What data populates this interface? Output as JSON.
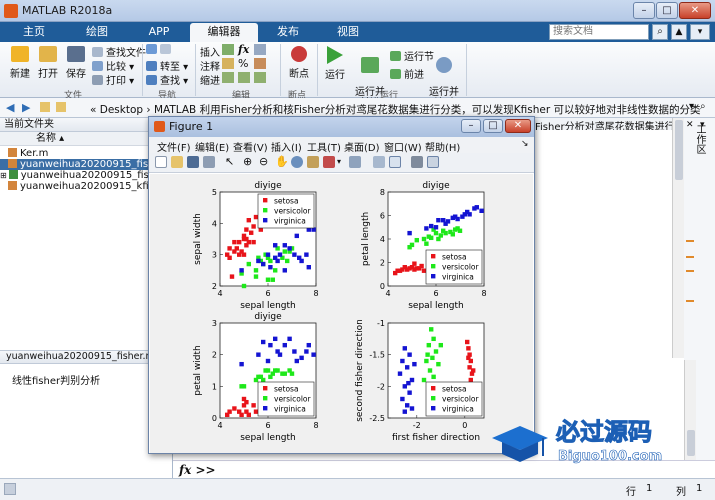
{
  "app": {
    "title": "MATLAB R2018a"
  },
  "ribbon_tabs": [
    "主页",
    "绘图",
    "APP",
    "编辑器",
    "发布",
    "视图"
  ],
  "search": {
    "placeholder": "搜索文档"
  },
  "ribbon": {
    "new": "新建",
    "open": "打开",
    "save": "保存",
    "find_files": "查找文件",
    "compare": "比较",
    "print": "打印",
    "goto": "转至",
    "find": "查找",
    "insert": "插入",
    "comment": "注释",
    "indent": "缩进",
    "breakpoint": "断点",
    "run": "运行",
    "run_advance": "运行并\n前进",
    "run_section": "运行节",
    "advance": "前进",
    "run_time": "运行并\n计时",
    "groups": {
      "file": "文件",
      "nav": "导航",
      "edit": "编辑",
      "breakpoint": "断点",
      "run": "运行"
    }
  },
  "address": {
    "path": "« Desktop › MATLAB 利用Fisher分析和核Fisher分析对鸢尾花数据集进行分类，可以发现Kfisher 可以较好地对非线性数据的分类"
  },
  "left_panel": {
    "header": "当前文件夹",
    "column": "名称",
    "files": [
      "Ker.m",
      "yuanweihua20200915_fisher.m",
      "yuanweihua20200915_fisher.m",
      "yuanweihua20200915_kfisher.m"
    ],
    "details_title": "yuanweihua20200915_fisher.m  (脚...",
    "details_text": "线性fisher判别分析"
  },
  "workspace": {
    "label": "工作区"
  },
  "editor_tab": {
    "label": "Fisher分析对鸢尾花数据集进行..."
  },
  "command": {
    "prompt": "fx >>"
  },
  "status": {
    "line_label": "行",
    "line": "1",
    "col_label": "列",
    "col": "1"
  },
  "figure": {
    "title": "Figure 1",
    "menu": [
      "文件(F)",
      "编辑(E)",
      "查看(V)",
      "插入(I)",
      "工具(T)",
      "桌面(D)",
      "窗口(W)",
      "帮助(H)"
    ]
  },
  "legend": [
    "setosa",
    "versicolor",
    "virginica"
  ],
  "colors": {
    "setosa": "#e8141a",
    "versicolor": "#1ee81a",
    "virginica": "#1414d2"
  },
  "chart_data": [
    {
      "type": "scatter",
      "title": "diyige",
      "xlabel": "sepal length",
      "ylabel": "sepal width",
      "xlim": [
        4,
        8
      ],
      "ylim": [
        2,
        5
      ],
      "xticks": [
        4,
        6,
        8
      ],
      "yticks": [
        2,
        3,
        4,
        5
      ],
      "legend_position": "top-right",
      "series": [
        {
          "name": "setosa",
          "points": [
            [
              4.3,
              3.0
            ],
            [
              4.4,
              2.9
            ],
            [
              4.4,
              3.2
            ],
            [
              4.5,
              2.3
            ],
            [
              4.6,
              3.1
            ],
            [
              4.6,
              3.4
            ],
            [
              4.7,
              3.2
            ],
            [
              4.8,
              3.0
            ],
            [
              4.8,
              3.4
            ],
            [
              4.9,
              3.1
            ],
            [
              5.0,
              3.0
            ],
            [
              5.0,
              3.5
            ],
            [
              5.0,
              3.6
            ],
            [
              5.1,
              3.3
            ],
            [
              5.1,
              3.5
            ],
            [
              5.1,
              3.8
            ],
            [
              5.2,
              3.4
            ],
            [
              5.2,
              4.1
            ],
            [
              5.3,
              3.7
            ],
            [
              5.4,
              3.4
            ],
            [
              5.4,
              3.9
            ],
            [
              5.5,
              4.2
            ],
            [
              5.7,
              3.8
            ],
            [
              5.7,
              4.4
            ],
            [
              5.8,
              4.0
            ]
          ]
        },
        {
          "name": "versicolor",
          "points": [
            [
              4.9,
              2.4
            ],
            [
              5.0,
              2.0
            ],
            [
              5.2,
              2.7
            ],
            [
              5.5,
              2.3
            ],
            [
              5.5,
              2.5
            ],
            [
              5.6,
              2.9
            ],
            [
              5.7,
              2.8
            ],
            [
              5.8,
              2.7
            ],
            [
              5.9,
              3.0
            ],
            [
              6.0,
              2.2
            ],
            [
              6.0,
              2.9
            ],
            [
              6.1,
              2.8
            ],
            [
              6.2,
              2.2
            ],
            [
              6.3,
              2.5
            ],
            [
              6.4,
              3.2
            ],
            [
              6.6,
              2.9
            ],
            [
              6.7,
              3.1
            ],
            [
              6.8,
              2.8
            ],
            [
              6.9,
              3.1
            ],
            [
              7.0,
              3.2
            ]
          ]
        },
        {
          "name": "virginica",
          "points": [
            [
              4.9,
              2.5
            ],
            [
              5.6,
              2.8
            ],
            [
              5.8,
              2.7
            ],
            [
              6.0,
              3.0
            ],
            [
              6.1,
              2.6
            ],
            [
              6.3,
              2.9
            ],
            [
              6.3,
              3.3
            ],
            [
              6.4,
              2.8
            ],
            [
              6.5,
              3.0
            ],
            [
              6.7,
              2.5
            ],
            [
              6.7,
              3.3
            ],
            [
              6.9,
              3.2
            ],
            [
              7.1,
              3.0
            ],
            [
              7.2,
              3.6
            ],
            [
              7.3,
              2.9
            ],
            [
              7.4,
              2.8
            ],
            [
              7.6,
              3.0
            ],
            [
              7.7,
              2.6
            ],
            [
              7.7,
              3.8
            ],
            [
              7.9,
              3.8
            ]
          ]
        }
      ]
    },
    {
      "type": "scatter",
      "title": "diyige",
      "xlabel": "sepal length",
      "ylabel": "petal length",
      "xlim": [
        4,
        8
      ],
      "ylim": [
        0,
        8
      ],
      "xticks": [
        4,
        6,
        8
      ],
      "yticks": [
        0,
        2,
        4,
        6,
        8
      ],
      "legend_position": "bottom-right",
      "series": [
        {
          "name": "setosa",
          "points": [
            [
              4.3,
              1.1
            ],
            [
              4.4,
              1.3
            ],
            [
              4.5,
              1.3
            ],
            [
              4.6,
              1.4
            ],
            [
              4.7,
              1.6
            ],
            [
              4.8,
              1.4
            ],
            [
              4.9,
              1.5
            ],
            [
              5.0,
              1.6
            ],
            [
              5.1,
              1.4
            ],
            [
              5.1,
              1.9
            ],
            [
              5.2,
              1.5
            ],
            [
              5.3,
              1.5
            ],
            [
              5.4,
              1.7
            ],
            [
              5.5,
              1.3
            ],
            [
              5.7,
              1.5
            ],
            [
              5.8,
              1.2
            ]
          ]
        },
        {
          "name": "versicolor",
          "points": [
            [
              4.9,
              3.3
            ],
            [
              5.0,
              3.5
            ],
            [
              5.2,
              3.9
            ],
            [
              5.5,
              4.0
            ],
            [
              5.6,
              3.6
            ],
            [
              5.7,
              4.2
            ],
            [
              5.8,
              4.1
            ],
            [
              5.9,
              4.8
            ],
            [
              6.0,
              4.5
            ],
            [
              6.1,
              4.0
            ],
            [
              6.2,
              4.3
            ],
            [
              6.3,
              4.7
            ],
            [
              6.4,
              4.5
            ],
            [
              6.6,
              4.6
            ],
            [
              6.7,
              4.4
            ],
            [
              6.8,
              4.8
            ],
            [
              6.9,
              4.9
            ],
            [
              7.0,
              4.7
            ]
          ]
        },
        {
          "name": "virginica",
          "points": [
            [
              4.9,
              4.5
            ],
            [
              5.6,
              4.9
            ],
            [
              5.8,
              5.1
            ],
            [
              6.0,
              5.0
            ],
            [
              6.1,
              5.6
            ],
            [
              6.3,
              5.6
            ],
            [
              6.4,
              5.3
            ],
            [
              6.5,
              5.5
            ],
            [
              6.7,
              5.8
            ],
            [
              6.8,
              5.9
            ],
            [
              6.9,
              5.7
            ],
            [
              7.1,
              5.9
            ],
            [
              7.2,
              6.1
            ],
            [
              7.3,
              6.3
            ],
            [
              7.4,
              6.1
            ],
            [
              7.6,
              6.6
            ],
            [
              7.7,
              6.7
            ],
            [
              7.9,
              6.4
            ]
          ]
        }
      ]
    },
    {
      "type": "scatter",
      "title": "diyige",
      "xlabel": "sepal length",
      "ylabel": "petal width",
      "xlim": [
        4,
        8
      ],
      "ylim": [
        0,
        3
      ],
      "xticks": [
        4,
        6,
        8
      ],
      "yticks": [
        0,
        1,
        2,
        3
      ],
      "legend_position": "bottom-right",
      "series": [
        {
          "name": "setosa",
          "points": [
            [
              4.3,
              0.1
            ],
            [
              4.4,
              0.2
            ],
            [
              4.6,
              0.3
            ],
            [
              4.8,
              0.2
            ],
            [
              4.9,
              0.1
            ],
            [
              5.0,
              0.4
            ],
            [
              5.1,
              0.2
            ],
            [
              5.2,
              0.1
            ],
            [
              5.4,
              0.4
            ],
            [
              5.5,
              0.2
            ],
            [
              5.7,
              0.3
            ],
            [
              5.8,
              0.2
            ],
            [
              5.1,
              0.5
            ],
            [
              5.0,
              0.6
            ]
          ]
        },
        {
          "name": "versicolor",
          "points": [
            [
              4.9,
              1.0
            ],
            [
              5.0,
              1.0
            ],
            [
              5.5,
              1.2
            ],
            [
              5.6,
              1.3
            ],
            [
              5.7,
              1.3
            ],
            [
              5.8,
              1.2
            ],
            [
              5.9,
              1.5
            ],
            [
              6.0,
              1.5
            ],
            [
              6.1,
              1.3
            ],
            [
              6.2,
              1.4
            ],
            [
              6.3,
              1.5
            ],
            [
              6.4,
              1.5
            ],
            [
              6.6,
              1.4
            ],
            [
              6.7,
              1.4
            ],
            [
              6.9,
              1.5
            ],
            [
              7.0,
              1.4
            ]
          ]
        },
        {
          "name": "virginica",
          "points": [
            [
              4.9,
              1.7
            ],
            [
              5.6,
              2.0
            ],
            [
              5.8,
              2.4
            ],
            [
              6.0,
              1.8
            ],
            [
              6.1,
              2.3
            ],
            [
              6.3,
              2.5
            ],
            [
              6.4,
              2.1
            ],
            [
              6.5,
              2.0
            ],
            [
              6.7,
              2.3
            ],
            [
              6.9,
              2.5
            ],
            [
              7.1,
              2.1
            ],
            [
              7.2,
              1.8
            ],
            [
              7.4,
              1.9
            ],
            [
              7.6,
              2.1
            ],
            [
              7.7,
              2.3
            ],
            [
              7.9,
              2.0
            ]
          ]
        }
      ]
    },
    {
      "type": "scatter",
      "title": "",
      "xlabel": "first fisher direction",
      "ylabel": "second fisher direction",
      "xlim": [
        -3.2,
        0.8
      ],
      "ylim": [
        -2.5,
        -1
      ],
      "xticks": [
        -2,
        0
      ],
      "yticks": [
        -2.5,
        -2,
        -1.5,
        -1
      ],
      "legend_position": "bottom-right",
      "series": [
        {
          "name": "setosa",
          "points": [
            [
              0.1,
              -1.3
            ],
            [
              0.15,
              -1.4
            ],
            [
              0.2,
              -1.5
            ],
            [
              0.25,
              -1.6
            ],
            [
              0.2,
              -1.7
            ],
            [
              0.3,
              -1.8
            ],
            [
              0.25,
              -1.9
            ],
            [
              0.35,
              -2.0
            ],
            [
              0.3,
              -2.1
            ],
            [
              0.4,
              -2.2
            ],
            [
              0.45,
              -2.3
            ],
            [
              0.5,
              -2.4
            ],
            [
              0.15,
              -1.55
            ],
            [
              0.35,
              -1.75
            ]
          ]
        },
        {
          "name": "versicolor",
          "points": [
            [
              -1.4,
              -1.1
            ],
            [
              -1.3,
              -1.25
            ],
            [
              -1.5,
              -1.35
            ],
            [
              -1.2,
              -1.45
            ],
            [
              -1.35,
              -1.55
            ],
            [
              -1.6,
              -1.6
            ],
            [
              -1.1,
              -1.65
            ],
            [
              -1.45,
              -1.75
            ],
            [
              -1.3,
              -1.85
            ],
            [
              -1.7,
              -1.9
            ],
            [
              -1.2,
              -2.0
            ],
            [
              -1.5,
              -2.05
            ],
            [
              -1.0,
              -1.35
            ],
            [
              -1.55,
              -1.5
            ]
          ]
        },
        {
          "name": "virginica",
          "points": [
            [
              -2.5,
              -1.4
            ],
            [
              -2.3,
              -1.5
            ],
            [
              -2.6,
              -1.6
            ],
            [
              -2.4,
              -1.7
            ],
            [
              -2.7,
              -1.8
            ],
            [
              -2.2,
              -1.9
            ],
            [
              -2.5,
              -2.0
            ],
            [
              -2.3,
              -2.1
            ],
            [
              -2.6,
              -2.2
            ],
            [
              -2.4,
              -2.3
            ],
            [
              -2.2,
              -2.35
            ],
            [
              -2.5,
              -2.4
            ],
            [
              -2.1,
              -1.65
            ],
            [
              -2.35,
              -1.95
            ]
          ]
        }
      ]
    }
  ]
}
